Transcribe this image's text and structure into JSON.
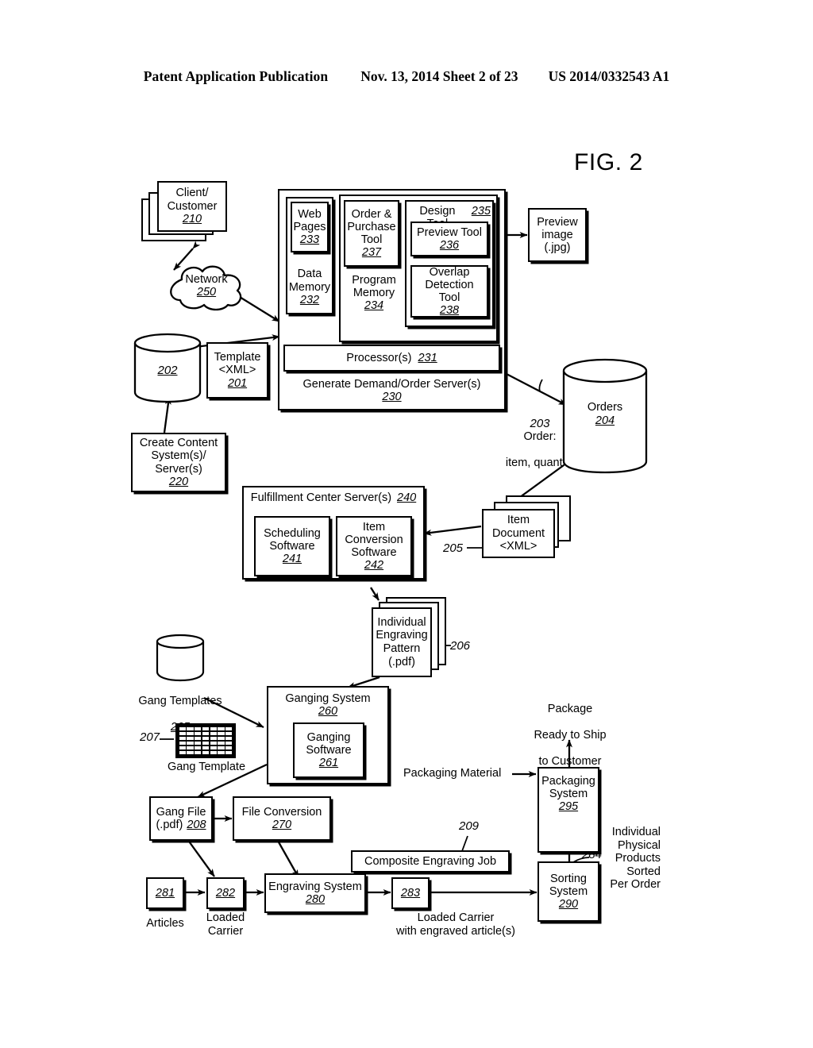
{
  "header": {
    "publication": "Patent Application Publication",
    "date_sheet": "Nov. 13, 2014  Sheet 2 of 23",
    "pub_number": "US 2014/0332543 A1"
  },
  "figure": {
    "title": "FIG. 2"
  },
  "nodes": {
    "client_customer": {
      "line1": "Client/",
      "line2": "Customer",
      "ref": "210"
    },
    "network": {
      "label": "Network",
      "ref": "250"
    },
    "template_xml": {
      "line1": "Template",
      "line2": "<XML>",
      "ref": "201"
    },
    "content_db": {
      "ref": "202"
    },
    "create_content": {
      "line1": "Create Content",
      "line2": "System(s)/",
      "line3": "Server(s)",
      "ref": "220"
    },
    "server": {
      "label": "Generate Demand/Order Server(s)",
      "ref": "230"
    },
    "processor": {
      "label": "Processor(s)",
      "ref": "231"
    },
    "data_memory": {
      "line1": "Data",
      "line2": "Memory",
      "ref": "232"
    },
    "web_pages": {
      "line1": "Web",
      "line2": "Pages",
      "ref": "233"
    },
    "program_memory": {
      "line1": "Program",
      "line2": "Memory",
      "ref": "234"
    },
    "design_tool": {
      "label": "Design Tool",
      "ref": "235"
    },
    "preview_tool": {
      "label": "Preview Tool",
      "ref": "236"
    },
    "order_purchase_tool": {
      "line1": "Order &",
      "line2": "Purchase",
      "line3": "Tool",
      "ref": "237"
    },
    "overlap_detection_tool": {
      "line1": "Overlap",
      "line2": "Detection Tool",
      "ref": "238"
    },
    "preview_image": {
      "line1": "Preview",
      "line2": "image",
      "line3": "(.jpg)"
    },
    "orders_db": {
      "label": "Orders",
      "ref": "204"
    },
    "order_flow": {
      "ref": "203",
      "line1": "Order:",
      "line2": "item, quantity"
    },
    "fulfillment_server": {
      "label": "Fulfillment Center Server(s)",
      "ref": "240"
    },
    "scheduling_software": {
      "line1": "Scheduling",
      "line2": "Software",
      "ref": "241"
    },
    "item_conversion_software": {
      "line1": "Item",
      "line2": "Conversion",
      "line3": "Software",
      "ref": "242"
    },
    "item_document": {
      "line1": "Item",
      "line2": "Document",
      "line3": "<XML>",
      "ref": "205"
    },
    "engraving_pattern": {
      "line1": "Individual",
      "line2": "Engraving",
      "line3": "Pattern",
      "line4": "(.pdf)",
      "ref": "206"
    },
    "gang_templates_db": {
      "label": "Gang Templates",
      "ref": "265"
    },
    "gang_template": {
      "label": "Gang Template",
      "ref": "207"
    },
    "ganging_system": {
      "label": "Ganging System",
      "ref": "260"
    },
    "ganging_software": {
      "line1": "Ganging",
      "line2": "Software",
      "ref": "261"
    },
    "gang_file": {
      "line1": "Gang File",
      "line2": "(.pdf)",
      "ref": "208"
    },
    "file_conversion": {
      "label": "File Conversion",
      "ref": "270"
    },
    "composite_job": {
      "label": "Composite Engraving Job",
      "ref": "209"
    },
    "articles": {
      "ref": "281",
      "caption": "Articles"
    },
    "loaded_carrier": {
      "ref": "282",
      "caption": "Loaded\nCarrier"
    },
    "engraving_system": {
      "label": "Engraving System",
      "ref": "280"
    },
    "loaded_carrier_engraved": {
      "ref": "283",
      "caption": "Loaded Carrier\nwith engraved article(s)"
    },
    "sorting_system": {
      "line1": "Sorting",
      "line2": "System",
      "ref": "290"
    },
    "sorted_products": {
      "ref": "284",
      "caption": "Individual\nPhysical\nProducts\nSorted\nPer Order"
    },
    "packaging_system": {
      "line1": "Packaging",
      "line2": "System",
      "ref": "295"
    },
    "packaging_material": {
      "label": "Packaging Material"
    },
    "package_ready": {
      "line1": "Package",
      "line2": "Ready to Ship",
      "line3": "to Customer"
    }
  },
  "colors": {
    "ink": "#000000",
    "paper": "#ffffff"
  }
}
